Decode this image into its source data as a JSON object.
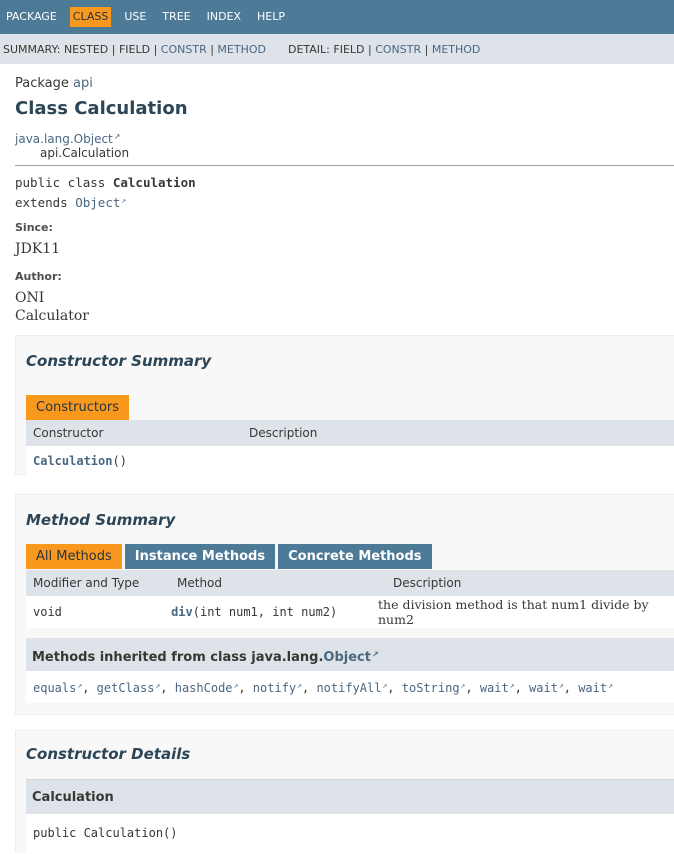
{
  "top_nav": {
    "items": [
      "PACKAGE",
      "CLASS",
      "USE",
      "TREE",
      "INDEX",
      "HELP"
    ],
    "active": "CLASS"
  },
  "sub_nav": {
    "summary_label": "SUMMARY:",
    "summary_nested": "NESTED",
    "summary_field": "FIELD",
    "summary_constr": "CONSTR",
    "summary_method": "METHOD",
    "detail_label": "DETAIL:",
    "detail_field": "FIELD",
    "detail_constr": "CONSTR",
    "detail_method": "METHOD",
    "separator": " | "
  },
  "header": {
    "package_label": "Package",
    "package_name": "api",
    "title": "Class Calculation",
    "inheritance_root": "java.lang.Object",
    "inheritance_child": "api.Calculation"
  },
  "signature": {
    "prefix": "public class ",
    "class_name": "Calculation",
    "extends_kw": "extends ",
    "extends_name": "Object"
  },
  "since": {
    "label": "Since:",
    "value": "JDK11"
  },
  "author": {
    "label": "Author:",
    "line1": "ONI",
    "line2": "Calculator"
  },
  "constructor_summary": {
    "title": "Constructor Summary",
    "tab": "Constructors",
    "col_constructor": "Constructor",
    "col_description": "Description",
    "row_name": "Calculation",
    "row_params": "()"
  },
  "method_summary": {
    "title": "Method Summary",
    "tabs": [
      "All Methods",
      "Instance Methods",
      "Concrete Methods"
    ],
    "col_modifier": "Modifier and Type",
    "col_method": "Method",
    "col_description": "Description",
    "row_type": "void",
    "row_name": "div",
    "row_params": "(int num1, int num2)",
    "row_description": "the division method is that num1 divide by num2",
    "inherited_prefix": "Methods inherited from class java.lang.",
    "inherited_class": "Object",
    "inherited_methods": [
      "equals",
      "getClass",
      "hashCode",
      "notify",
      "notifyAll",
      "toString",
      "wait",
      "wait",
      "wait"
    ]
  },
  "constructor_details": {
    "title": "Constructor Details",
    "name": "Calculation",
    "signature": "public Calculation()"
  },
  "colors": {
    "nav_bg": "#4d7a97",
    "active_tab": "#f8981d",
    "table_header": "#dee3e9",
    "link": "#4a6782",
    "title": "#2c4557"
  }
}
